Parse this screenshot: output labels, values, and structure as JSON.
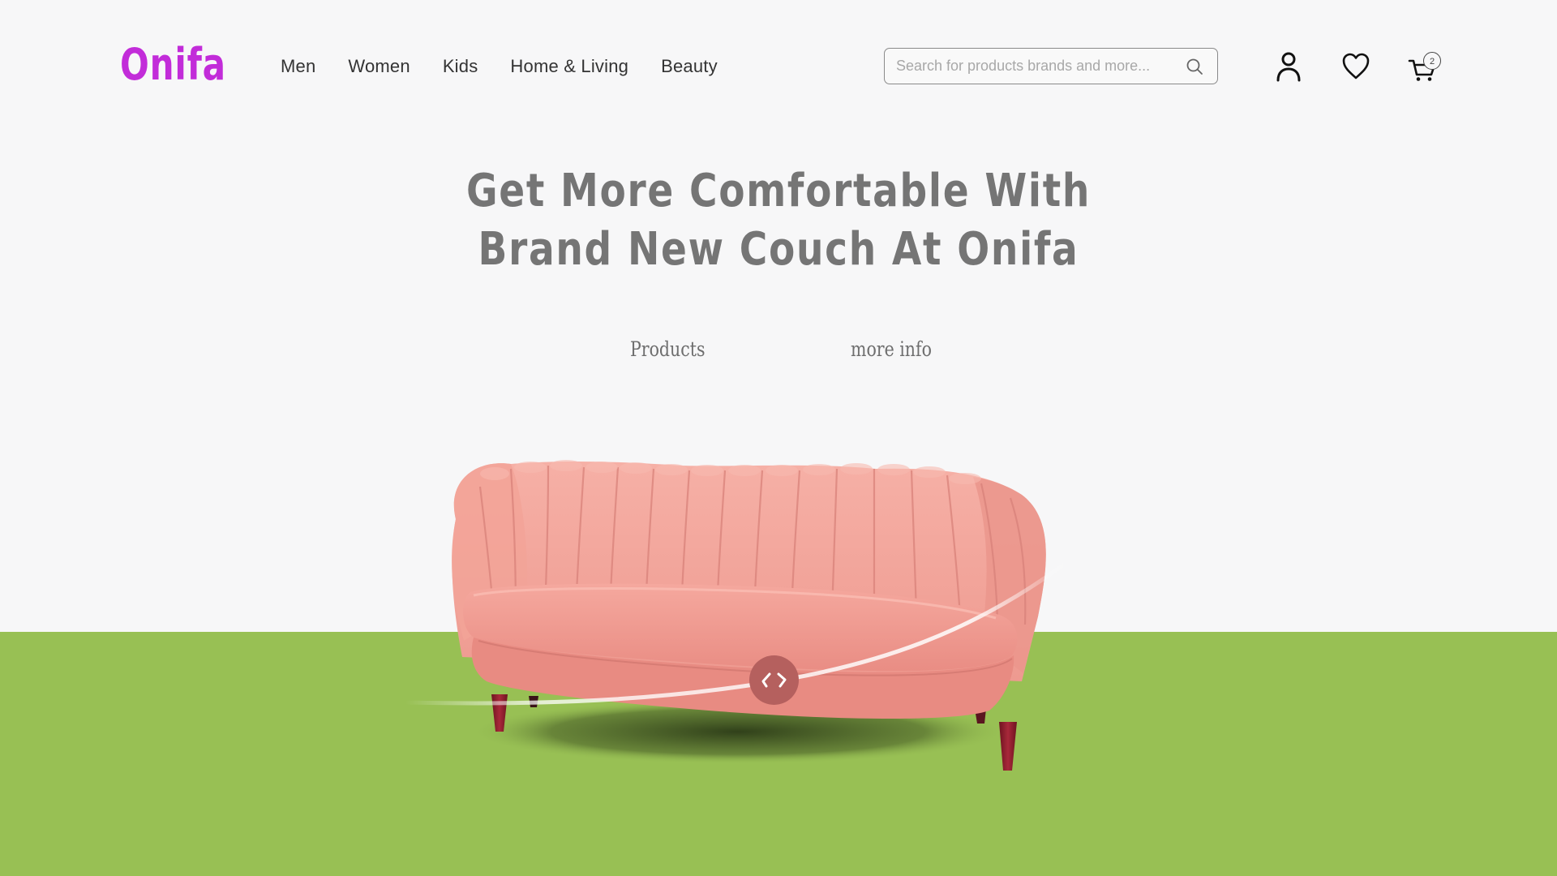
{
  "brand": {
    "logo": "Onifa",
    "color": "#c22cd9"
  },
  "nav": {
    "items": [
      "Men",
      "Women",
      "Kids",
      "Home & Living",
      "Beauty"
    ]
  },
  "search": {
    "placeholder": "Search for products brands and more...",
    "value": ""
  },
  "header_icons": {
    "user": "user-icon",
    "wishlist": "heart-icon",
    "cart": "cart-icon",
    "cart_count": "2"
  },
  "hero": {
    "title_line1": "Get More Comfortable With",
    "title_line2": "Brand New Couch At Onifa",
    "products_link": "Products",
    "more_info_link": "more info"
  },
  "colors": {
    "background": "#f7f7f8",
    "floor": "#98c054",
    "sofa": "#f3a097",
    "heading": "#757575",
    "slider_button": "#b5605e"
  }
}
